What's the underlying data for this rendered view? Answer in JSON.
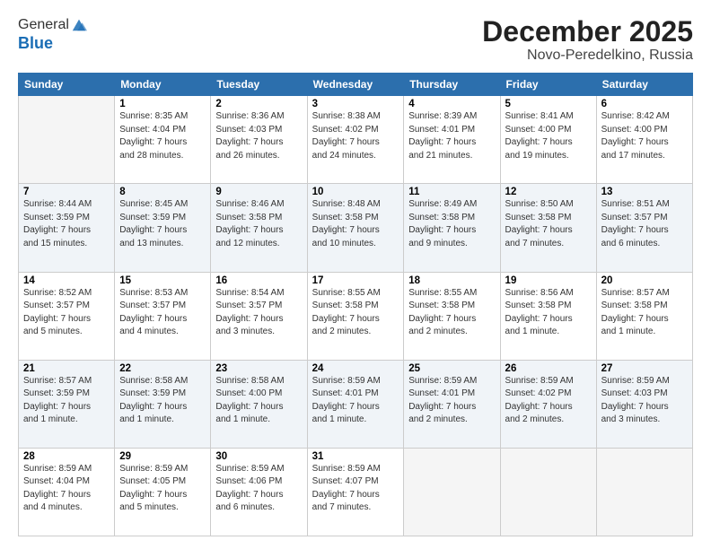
{
  "header": {
    "logo_general": "General",
    "logo_blue": "Blue",
    "month_title": "December 2025",
    "location": "Novo-Peredelkino, Russia"
  },
  "days_of_week": [
    "Sunday",
    "Monday",
    "Tuesday",
    "Wednesday",
    "Thursday",
    "Friday",
    "Saturday"
  ],
  "weeks": [
    [
      {
        "num": "",
        "info": ""
      },
      {
        "num": "1",
        "info": "Sunrise: 8:35 AM\nSunset: 4:04 PM\nDaylight: 7 hours\nand 28 minutes."
      },
      {
        "num": "2",
        "info": "Sunrise: 8:36 AM\nSunset: 4:03 PM\nDaylight: 7 hours\nand 26 minutes."
      },
      {
        "num": "3",
        "info": "Sunrise: 8:38 AM\nSunset: 4:02 PM\nDaylight: 7 hours\nand 24 minutes."
      },
      {
        "num": "4",
        "info": "Sunrise: 8:39 AM\nSunset: 4:01 PM\nDaylight: 7 hours\nand 21 minutes."
      },
      {
        "num": "5",
        "info": "Sunrise: 8:41 AM\nSunset: 4:00 PM\nDaylight: 7 hours\nand 19 minutes."
      },
      {
        "num": "6",
        "info": "Sunrise: 8:42 AM\nSunset: 4:00 PM\nDaylight: 7 hours\nand 17 minutes."
      }
    ],
    [
      {
        "num": "7",
        "info": "Sunrise: 8:44 AM\nSunset: 3:59 PM\nDaylight: 7 hours\nand 15 minutes."
      },
      {
        "num": "8",
        "info": "Sunrise: 8:45 AM\nSunset: 3:59 PM\nDaylight: 7 hours\nand 13 minutes."
      },
      {
        "num": "9",
        "info": "Sunrise: 8:46 AM\nSunset: 3:58 PM\nDaylight: 7 hours\nand 12 minutes."
      },
      {
        "num": "10",
        "info": "Sunrise: 8:48 AM\nSunset: 3:58 PM\nDaylight: 7 hours\nand 10 minutes."
      },
      {
        "num": "11",
        "info": "Sunrise: 8:49 AM\nSunset: 3:58 PM\nDaylight: 7 hours\nand 9 minutes."
      },
      {
        "num": "12",
        "info": "Sunrise: 8:50 AM\nSunset: 3:58 PM\nDaylight: 7 hours\nand 7 minutes."
      },
      {
        "num": "13",
        "info": "Sunrise: 8:51 AM\nSunset: 3:57 PM\nDaylight: 7 hours\nand 6 minutes."
      }
    ],
    [
      {
        "num": "14",
        "info": "Sunrise: 8:52 AM\nSunset: 3:57 PM\nDaylight: 7 hours\nand 5 minutes."
      },
      {
        "num": "15",
        "info": "Sunrise: 8:53 AM\nSunset: 3:57 PM\nDaylight: 7 hours\nand 4 minutes."
      },
      {
        "num": "16",
        "info": "Sunrise: 8:54 AM\nSunset: 3:57 PM\nDaylight: 7 hours\nand 3 minutes."
      },
      {
        "num": "17",
        "info": "Sunrise: 8:55 AM\nSunset: 3:58 PM\nDaylight: 7 hours\nand 2 minutes."
      },
      {
        "num": "18",
        "info": "Sunrise: 8:55 AM\nSunset: 3:58 PM\nDaylight: 7 hours\nand 2 minutes."
      },
      {
        "num": "19",
        "info": "Sunrise: 8:56 AM\nSunset: 3:58 PM\nDaylight: 7 hours\nand 1 minute."
      },
      {
        "num": "20",
        "info": "Sunrise: 8:57 AM\nSunset: 3:58 PM\nDaylight: 7 hours\nand 1 minute."
      }
    ],
    [
      {
        "num": "21",
        "info": "Sunrise: 8:57 AM\nSunset: 3:59 PM\nDaylight: 7 hours\nand 1 minute."
      },
      {
        "num": "22",
        "info": "Sunrise: 8:58 AM\nSunset: 3:59 PM\nDaylight: 7 hours\nand 1 minute."
      },
      {
        "num": "23",
        "info": "Sunrise: 8:58 AM\nSunset: 4:00 PM\nDaylight: 7 hours\nand 1 minute."
      },
      {
        "num": "24",
        "info": "Sunrise: 8:59 AM\nSunset: 4:01 PM\nDaylight: 7 hours\nand 1 minute."
      },
      {
        "num": "25",
        "info": "Sunrise: 8:59 AM\nSunset: 4:01 PM\nDaylight: 7 hours\nand 2 minutes."
      },
      {
        "num": "26",
        "info": "Sunrise: 8:59 AM\nSunset: 4:02 PM\nDaylight: 7 hours\nand 2 minutes."
      },
      {
        "num": "27",
        "info": "Sunrise: 8:59 AM\nSunset: 4:03 PM\nDaylight: 7 hours\nand 3 minutes."
      }
    ],
    [
      {
        "num": "28",
        "info": "Sunrise: 8:59 AM\nSunset: 4:04 PM\nDaylight: 7 hours\nand 4 minutes."
      },
      {
        "num": "29",
        "info": "Sunrise: 8:59 AM\nSunset: 4:05 PM\nDaylight: 7 hours\nand 5 minutes."
      },
      {
        "num": "30",
        "info": "Sunrise: 8:59 AM\nSunset: 4:06 PM\nDaylight: 7 hours\nand 6 minutes."
      },
      {
        "num": "31",
        "info": "Sunrise: 8:59 AM\nSunset: 4:07 PM\nDaylight: 7 hours\nand 7 minutes."
      },
      {
        "num": "",
        "info": ""
      },
      {
        "num": "",
        "info": ""
      },
      {
        "num": "",
        "info": ""
      }
    ]
  ]
}
